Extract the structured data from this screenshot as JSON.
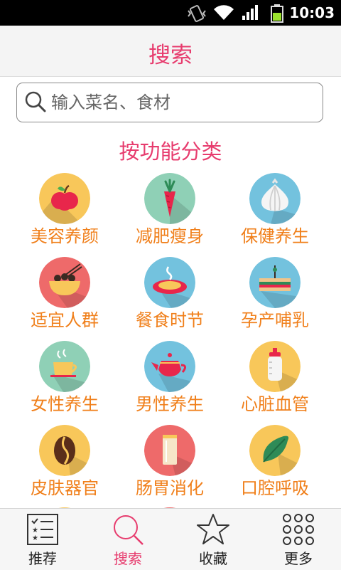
{
  "status_bar": {
    "time": "10:03"
  },
  "header": {
    "title": "搜索"
  },
  "search": {
    "placeholder": "输入菜名、食材"
  },
  "section": {
    "title": "按功能分类"
  },
  "categories": [
    {
      "label": "美容养颜",
      "icon": "apple-icon",
      "color": "#f8c75a"
    },
    {
      "label": "减肥瘦身",
      "icon": "carrot-icon",
      "color": "#8fd0b6"
    },
    {
      "label": "保健养生",
      "icon": "garlic-icon",
      "color": "#73c2de"
    },
    {
      "label": "适宜人群",
      "icon": "noodle-bowl-icon",
      "color": "#ee6a6a"
    },
    {
      "label": "餐食时节",
      "icon": "steaming-dish-icon",
      "color": "#73c2de"
    },
    {
      "label": "孕产哺乳",
      "icon": "sandwich-icon",
      "color": "#73c2de"
    },
    {
      "label": "女性养生",
      "icon": "tea-cup-icon",
      "color": "#8fd0b6"
    },
    {
      "label": "男性养生",
      "icon": "teapot-icon",
      "color": "#73c2de"
    },
    {
      "label": "心脏血管",
      "icon": "milk-bottle-icon",
      "color": "#f8c75a"
    },
    {
      "label": "皮肤器官",
      "icon": "coffee-bean-icon",
      "color": "#f8c75a"
    },
    {
      "label": "肠胃消化",
      "icon": "drink-glass-icon",
      "color": "#ee6a6a"
    },
    {
      "label": "口腔呼吸",
      "icon": "leaf-icon",
      "color": "#f8c75a"
    }
  ],
  "tabs": [
    {
      "label": "推荐",
      "icon": "list-icon",
      "active": false
    },
    {
      "label": "搜索",
      "icon": "search-icon",
      "active": true
    },
    {
      "label": "收藏",
      "icon": "star-icon",
      "active": false
    },
    {
      "label": "更多",
      "icon": "grid-dots-icon",
      "active": false
    }
  ],
  "colors": {
    "accent": "#e73c6e",
    "label_orange": "#f07f1a",
    "shadow": "rgba(0,0,0,0.13)"
  }
}
